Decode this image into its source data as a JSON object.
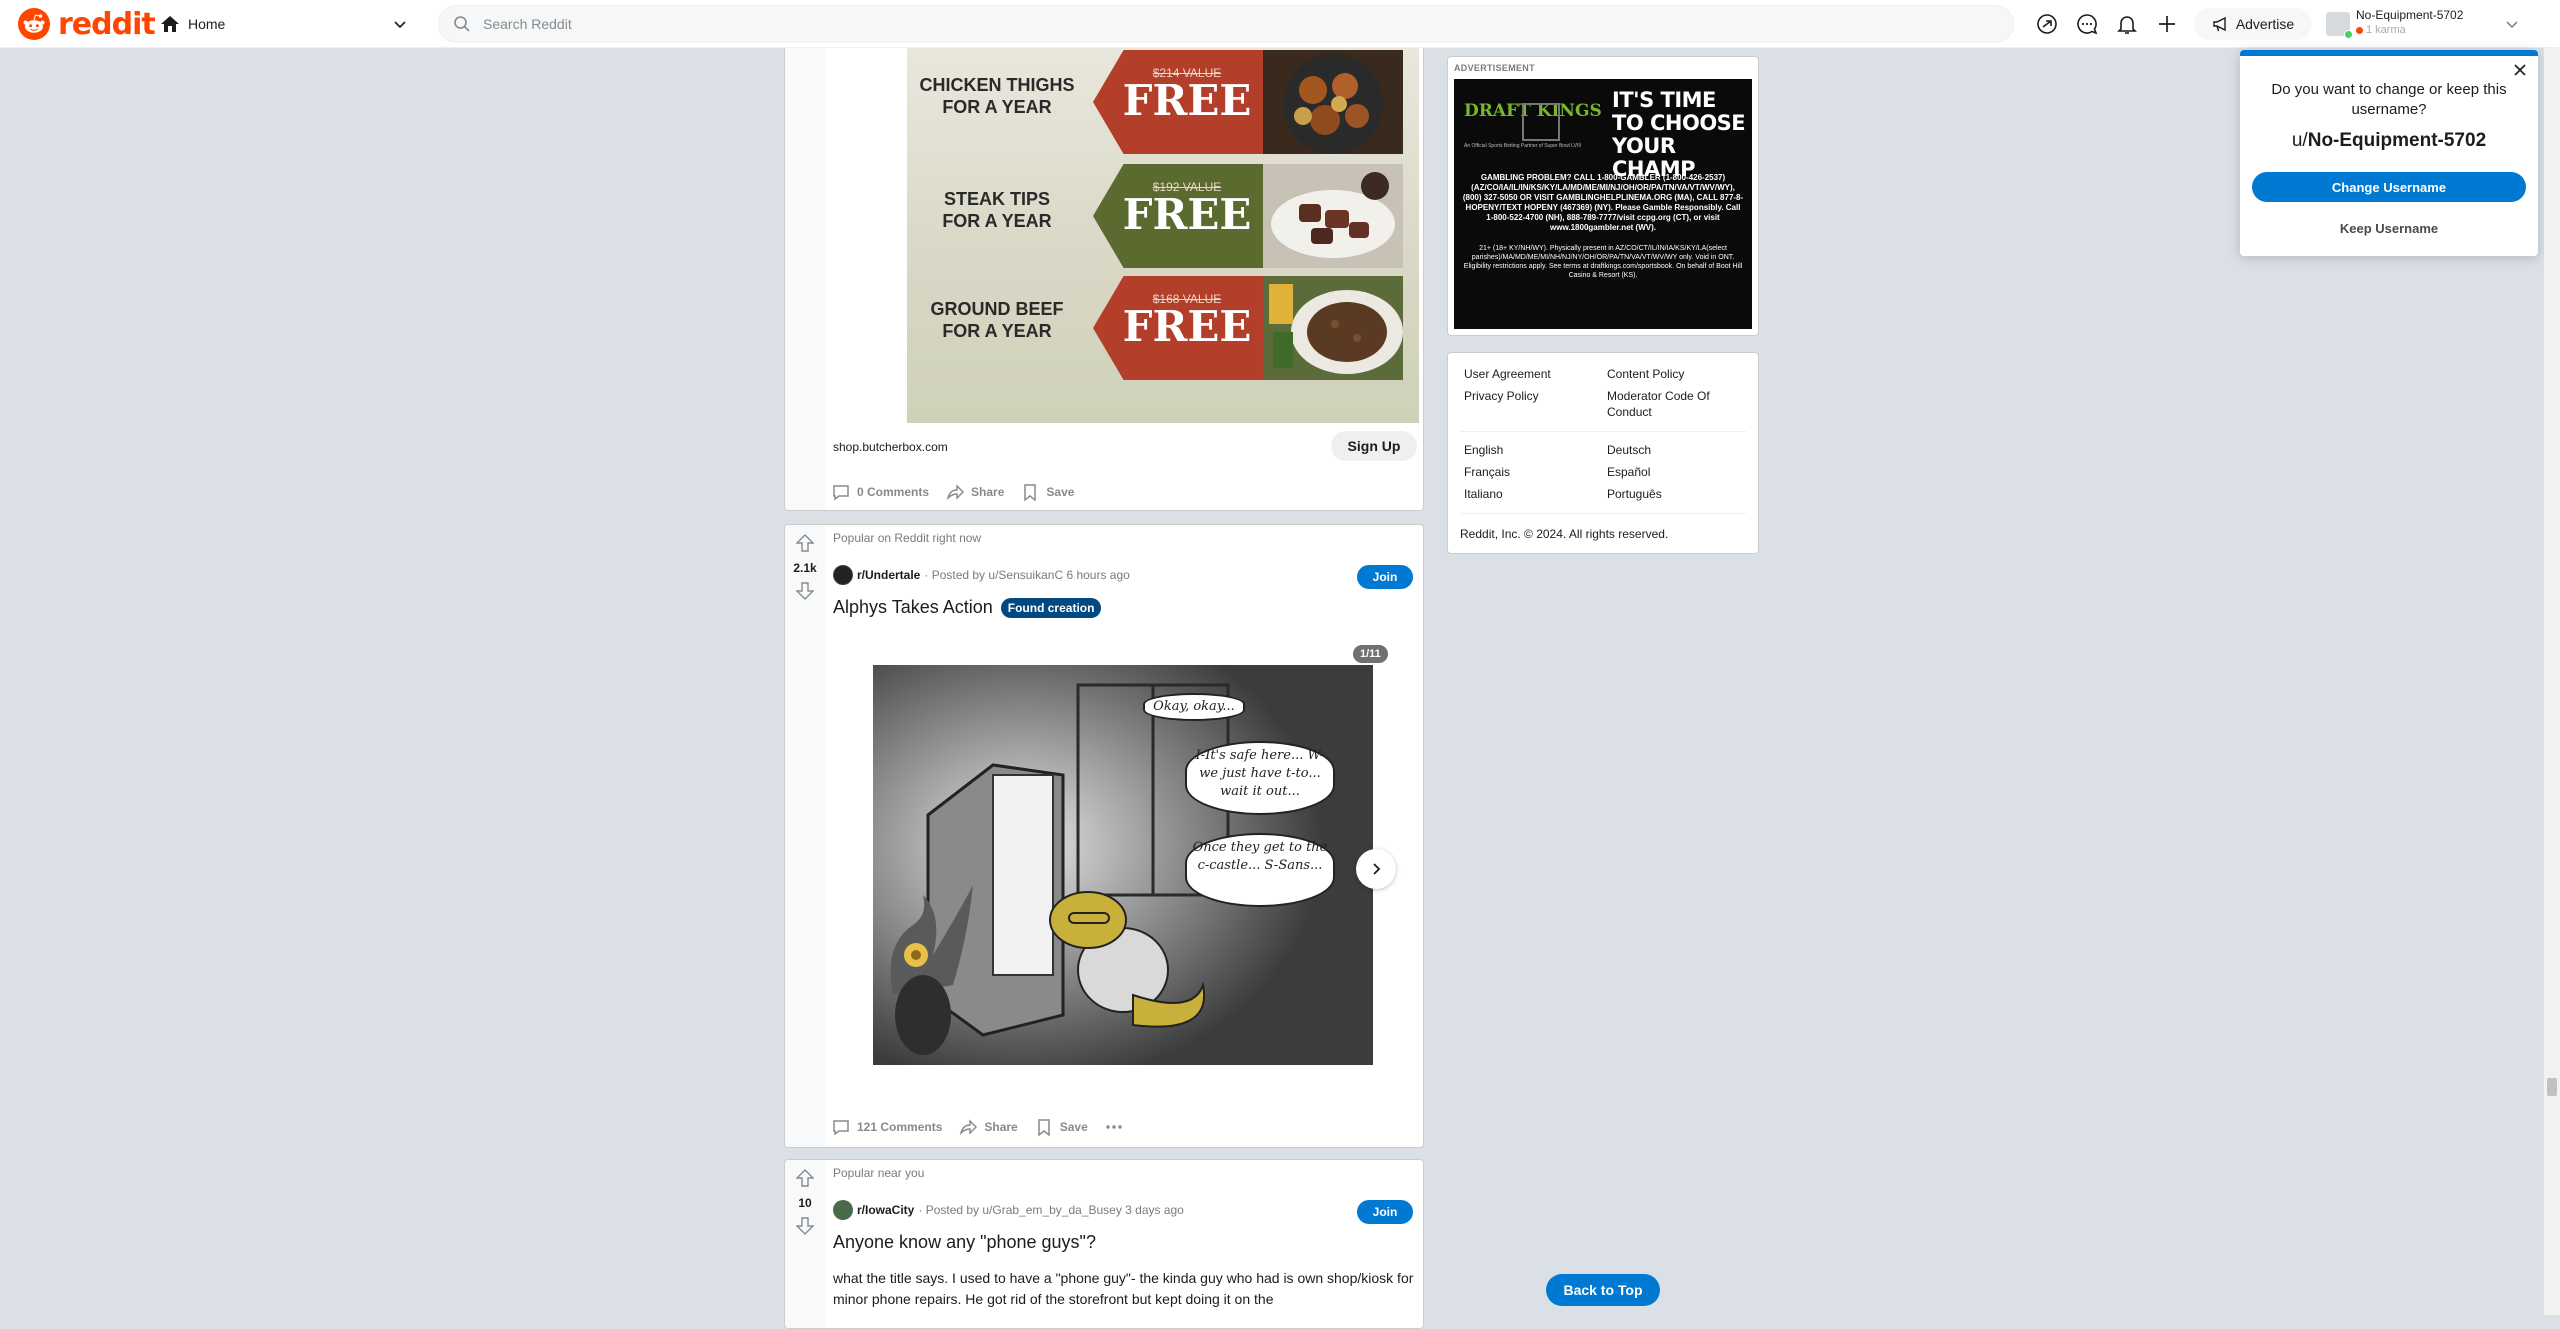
{
  "header": {
    "logo_text": "reddit",
    "home_label": "Home",
    "search_placeholder": "Search Reddit",
    "advertise_label": "Advertise",
    "user_name": "No-Equipment-5702",
    "user_karma": "1 karma"
  },
  "ad_post": {
    "rows": [
      {
        "label_line1": "CHICKEN THIGHS",
        "label_line2": "FOR A YEAR",
        "was": "$214 VALUE",
        "free": "FREE",
        "color": "#b33f2b"
      },
      {
        "label_line1": "STEAK TIPS",
        "label_line2": "FOR A YEAR",
        "was": "$192 VALUE",
        "free": "FREE",
        "color": "#5b6a2e"
      },
      {
        "label_line1": "GROUND BEEF",
        "label_line2": "FOR A YEAR",
        "was": "$168 VALUE",
        "free": "FREE",
        "color": "#b33f2b"
      }
    ],
    "domain": "shop.butcherbox.com",
    "signup_label": "Sign Up",
    "comments_label": "0 Comments",
    "share_label": "Share",
    "save_label": "Save"
  },
  "post1": {
    "tag": "Popular on Reddit right now",
    "score": "2.1k",
    "subreddit": "r/Undertale",
    "posted_by": "· Posted by u/SensuikanC 6 hours ago",
    "join_label": "Join",
    "title": "Alphys Takes Action",
    "flair": "Found creation",
    "counter": "1/11",
    "bubble1": "Okay, okay...",
    "bubble2": "I-It's safe here... W-we just have t-to... wait it out...",
    "bubble3": "Once they get to the c-castle... S-Sans...",
    "comments_label": "121 Comments",
    "share_label": "Share",
    "save_label": "Save"
  },
  "post2": {
    "tag": "Popular near you",
    "score": "10",
    "subreddit": "r/IowaCity",
    "posted_by": "· Posted by u/Grab_em_by_da_Busey 3 days ago",
    "join_label": "Join",
    "title": "Anyone know any \"phone guys\"?",
    "body": "what the title says. I used to have a \"phone guy\"- the kinda guy who had is own shop/kiosk for minor phone repairs. He got rid of the storefront but kept doing it on the"
  },
  "sidebar": {
    "ad_label": "ADVERTISEMENT",
    "dk_logo": "DRAFT KINGS",
    "dk_sub": "An Official Sports Betting Partner of Super Bowl LVIII",
    "dk_headline": "IT'S TIME TO CHOOSE YOUR CHAMP",
    "dk_fine": "GAMBLING PROBLEM? CALL 1-800-GAMBLER (1-800-426-2537) (AZ/CO/IA/IL/IN/KS/KY/LA/MD/ME/MI/NJ/OH/OR/PA/TN/VA/VT/WV/WY), (800) 327-5050 OR VISIT GAMBLINGHELPLINEMA.ORG (MA), CALL 877-8-HOPENY/TEXT HOPENY (467369) (NY). Please Gamble Responsibly. Call 1-800-522-4700 (NH), 888-789-7777/visit ccpg.org (CT), or visit www.1800gambler.net (WV).",
    "dk_fine2": "21+ (18+ KY/NH/WY). Physically present in AZ/CO/CT/IL/IN/IA/KS/KY/LA(select parishes)/MA/MD/ME/MI/NH/NJ/NY/OH/OR/PA/TN/VA/VT/WV/WY only. Void in ONT. Eligibility restrictions apply. See terms at draftkings.com/sportsbook. On behalf of Boot Hill Casino & Resort (KS).",
    "links": {
      "user_agreement": "User Agreement",
      "content_policy": "Content Policy",
      "privacy_policy": "Privacy Policy",
      "moderator_code": "Moderator Code Of Conduct",
      "english": "English",
      "deutsch": "Deutsch",
      "francais": "Français",
      "espanol": "Español",
      "italiano": "Italiano",
      "portugues": "Português"
    },
    "copyright": "Reddit, Inc. © 2024. All rights reserved."
  },
  "popup": {
    "question": "Do you want to change or keep this username?",
    "prefix": "u/",
    "username": "No-Equipment-5702",
    "change_label": "Change Username",
    "keep_label": "Keep Username"
  },
  "back_to_top": "Back to Top",
  "colors": {
    "brand": "#ff4500",
    "accent": "#0079d3",
    "flair": "#014980",
    "background": "#dae0e6"
  }
}
